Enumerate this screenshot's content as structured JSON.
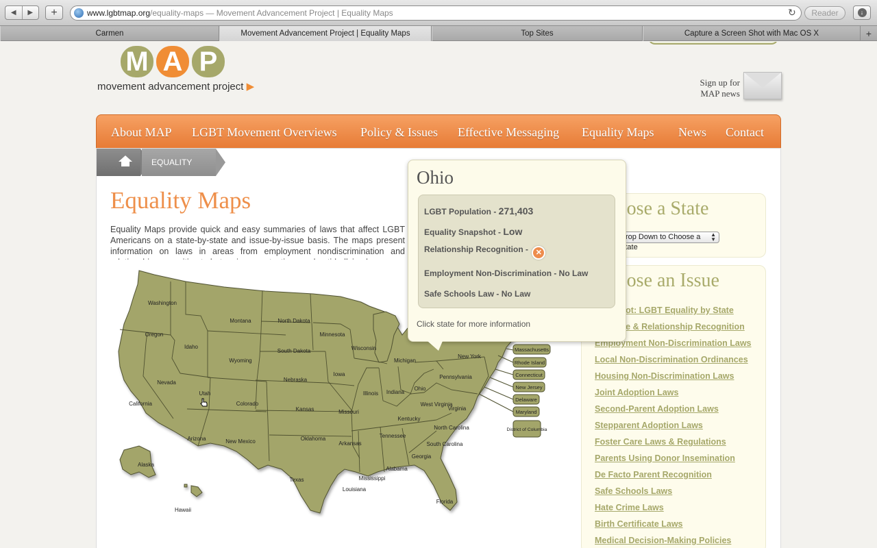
{
  "browser": {
    "url_host": "www.lgbtmap.org",
    "url_path": "/equality-maps",
    "url_title": " — Movement Advancement Project | Equality Maps",
    "reader_label": "Reader",
    "tabs": [
      "Carmen",
      "Movement Advancement Project | Equality Maps",
      "Top Sites",
      "Capture a Screen Shot with Mac OS X"
    ],
    "new_tab": "+"
  },
  "logo": {
    "letters": [
      "M",
      "A",
      "P"
    ],
    "tagline": "movement advancement project"
  },
  "signup": {
    "line1": "Sign up for",
    "line2": "MAP news"
  },
  "nav": [
    "About MAP",
    "LGBT Movement Overviews",
    "Policy & Issues",
    "Effective Messaging",
    "Equality Maps",
    "News",
    "Contact"
  ],
  "breadcrumb": {
    "current": "EQUALITY MAPS"
  },
  "page": {
    "title": "Equality Maps",
    "intro": "Equality Maps provide quick and easy summaries of laws that affect LGBT Americans on a state-by-state and issue-by-issue basis. The maps present information on laws in areas from employment nondiscrimination and relationship recognition to hate crimes protections and anti-bullying laws."
  },
  "map": {
    "states": [
      "Washington",
      "Oregon",
      "California",
      "Idaho",
      "Nevada",
      "Montana",
      "Wyoming",
      "Utah",
      "Arizona",
      "Colorado",
      "New Mexico",
      "North Dakota",
      "South Dakota",
      "Nebraska",
      "Kansas",
      "Oklahoma",
      "Texas",
      "Minnesota",
      "Iowa",
      "Missouri",
      "Arkansas",
      "Louisiana",
      "Wisconsin",
      "Illinois",
      "Michigan",
      "Indiana",
      "Ohio",
      "Kentucky",
      "Tennessee",
      "Mississippi",
      "Alabama",
      "Georgia",
      "Florida",
      "South Carolina",
      "North Carolina",
      "Virginia",
      "West Virginia",
      "Pennsylvania",
      "New York",
      "Alaska",
      "Hawaii"
    ],
    "northeast_labels": [
      "Massachusetts",
      "Rhode Island",
      "Connecticut",
      "New Jersey",
      "Delaware",
      "Maryland",
      "District of Columbia"
    ],
    "land_color": "#a3a56a",
    "border_color": "#4f5130"
  },
  "popup": {
    "state": "Ohio",
    "population_label": "LGBT Population - ",
    "population_value": "271,403",
    "snapshot_label": "Equality Snapshot - ",
    "snapshot_value": "Low",
    "relationship_label": "Relationship Recognition -",
    "relationship_icon": "x-icon",
    "employment": "Employment Non-Discrimination - No Law",
    "schools": "Safe Schools Law - No Law",
    "footer": "Click state for more information"
  },
  "sidebar": {
    "choose_state_heading": "Choose a State",
    "select_value": "Drop Down to Choose a State",
    "choose_issue_heading": "Choose an Issue",
    "issues": [
      "Snapshot: LGBT Equality by State",
      "Marriage & Relationship Recognition",
      "Employment Non-Discrimination Laws",
      "Local Non-Discrimination Ordinances",
      "Housing Non-Discrimination Laws",
      "Joint Adoption Laws",
      "Second-Parent Adoption Laws",
      "Stepparent Adoption Laws",
      "Foster Care Laws & Regulations",
      "Parents Using Donor Insemination",
      "De Facto Parent Recognition",
      "Safe Schools Laws",
      "Hate Crime Laws",
      "Birth Certificate Laws",
      "Medical Decision-Making Policies"
    ]
  },
  "colors": {
    "accent_orange": "#ef8f49",
    "olive": "#a6a86a",
    "cream": "#fefcec"
  }
}
